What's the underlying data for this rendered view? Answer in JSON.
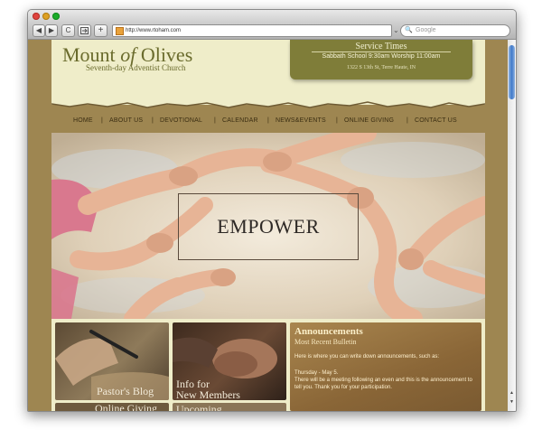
{
  "browser": {
    "url": "http://www.rtoham.com",
    "search_placeholder": "Google",
    "back_glyph": "◀",
    "forward_glyph": "▶",
    "reload_glyph": "C",
    "add_glyph": "+",
    "stop_glyph": "⌄"
  },
  "site": {
    "logo": {
      "word1": "Mount",
      "word2": "of",
      "word3": "Olives",
      "tagline": "Seventh-day  Adventist Church"
    },
    "service": {
      "title": "Service Times",
      "times": "Sabbath School 9:30am     Worship 11:00am",
      "address": "1322 S 13th St, Terre Haute, IN"
    },
    "nav": [
      "HOME",
      "ABOUT US",
      "DEVOTIONAL",
      "CALENDAR",
      "NEWS&EVENTS",
      "ONLINE GIVING",
      "CONTACT US"
    ],
    "hero": {
      "headline": "EMPOWER"
    },
    "tiles": {
      "pastors_blog": "Pastor's Blog",
      "info_line1": "Info for",
      "info_line2": "New Members",
      "online_giving": "Online Giving",
      "upcoming": "Upcoming"
    },
    "announcements": {
      "title": "Announcements",
      "subtitle": "Most Recent Bulletin",
      "intro": "Here is where you can write down announcements, such as:",
      "date": "Thursday - May 5.",
      "body": "There will be a meeting following an even and this is the announcement to tell you. Thank you for your participation."
    }
  },
  "colors": {
    "page_background": "#9e8651",
    "header_cream": "#efedc9",
    "olive_accent": "#7f7d39",
    "nav_text": "#3b2e12"
  }
}
